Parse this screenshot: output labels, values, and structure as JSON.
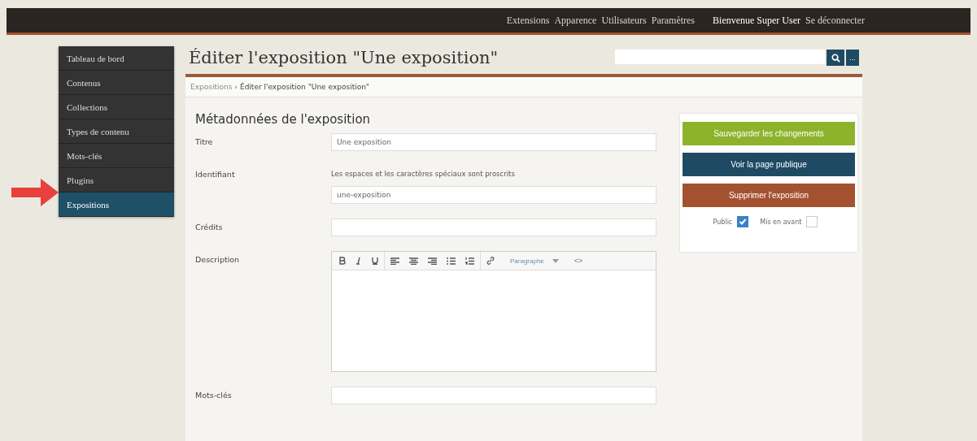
{
  "top_nav": {
    "links": [
      "Extensions",
      "Apparence",
      "Utilisateurs",
      "Paramètres"
    ],
    "welcome": "Bienvenue Super User",
    "logout": "Se déconnecter"
  },
  "sidebar": {
    "items": [
      {
        "label": "Tableau de bord",
        "selected": false
      },
      {
        "label": "Contenus",
        "selected": false
      },
      {
        "label": "Collections",
        "selected": false
      },
      {
        "label": "Types de contenu",
        "selected": false
      },
      {
        "label": "Mots-clés",
        "selected": false
      },
      {
        "label": "Plugins",
        "selected": false
      },
      {
        "label": "Expositions",
        "selected": true
      }
    ]
  },
  "page_title": "Éditer l'exposition \"Une exposition\"",
  "search": {
    "more": "..."
  },
  "breadcrumb": {
    "parent": "Expositions",
    "separator": "›",
    "current": "Éditer l'exposition \"Une exposition\""
  },
  "section_title": "Métadonnées de l'exposition",
  "fields": [
    {
      "kind": "text",
      "label": "Titre",
      "value": "Une exposition"
    },
    {
      "kind": "text",
      "label": "Identifiant",
      "hint": "Les espaces et les caractères spéciaux sont proscrits",
      "value": "une-exposition"
    },
    {
      "kind": "text",
      "label": "Crédits"
    },
    {
      "kind": "editor",
      "label": "Description",
      "format": "Paragraphe",
      "code": "<>"
    },
    {
      "kind": "text",
      "label": "Mots-clés"
    }
  ],
  "actions": [
    {
      "label": "Sauvegarder les changements",
      "color": "#8cb32b"
    },
    {
      "label": "Voir la page publique",
      "color": "#1e4b63"
    },
    {
      "label": "Supprimer l'exposition",
      "color": "#a4512f"
    }
  ],
  "options": [
    {
      "label": "Public",
      "checked": true
    },
    {
      "label": "Mis en avant",
      "checked": false
    }
  ]
}
